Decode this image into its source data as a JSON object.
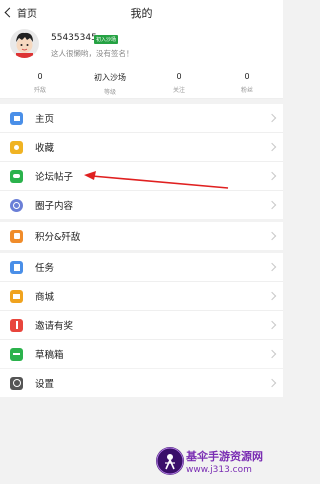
{
  "header": {
    "back_label": "首页",
    "title": "我的"
  },
  "profile": {
    "username": "55435345",
    "badge": "初入沙场",
    "signature": "这人很懒哟，没有签名！"
  },
  "stats": [
    {
      "value": "0",
      "label": "歼敌"
    },
    {
      "value": "初入沙场",
      "label": "等级"
    },
    {
      "value": "0",
      "label": "关注"
    },
    {
      "value": "0",
      "label": "粉丝"
    }
  ],
  "menu_group1": [
    {
      "label": "主页",
      "icon": "home-icon",
      "color": "#4a8fe8"
    },
    {
      "label": "收藏",
      "icon": "favorite-icon",
      "color": "#f0b323"
    },
    {
      "label": "论坛帖子",
      "icon": "forum-post-icon",
      "color": "#2bb24c"
    },
    {
      "label": "圈子内容",
      "icon": "circle-icon",
      "color": "#6b7fd7"
    }
  ],
  "menu_group2": [
    {
      "label": "积分&歼敌",
      "icon": "points-icon",
      "color": "#f08c2a"
    }
  ],
  "menu_group3": [
    {
      "label": "任务",
      "icon": "task-icon",
      "color": "#4a8fe8"
    },
    {
      "label": "商城",
      "icon": "shop-icon",
      "color": "#f0a31e"
    },
    {
      "label": "邀请有奖",
      "icon": "gift-icon",
      "color": "#e8453c"
    },
    {
      "label": "草稿箱",
      "icon": "draft-icon",
      "color": "#2bb24c"
    }
  ],
  "menu_group4": [
    {
      "label": "设置",
      "icon": "settings-icon",
      "color": "#555555"
    }
  ],
  "watermark": {
    "name": "基伞手游资源网",
    "url": "www.j313.com"
  }
}
